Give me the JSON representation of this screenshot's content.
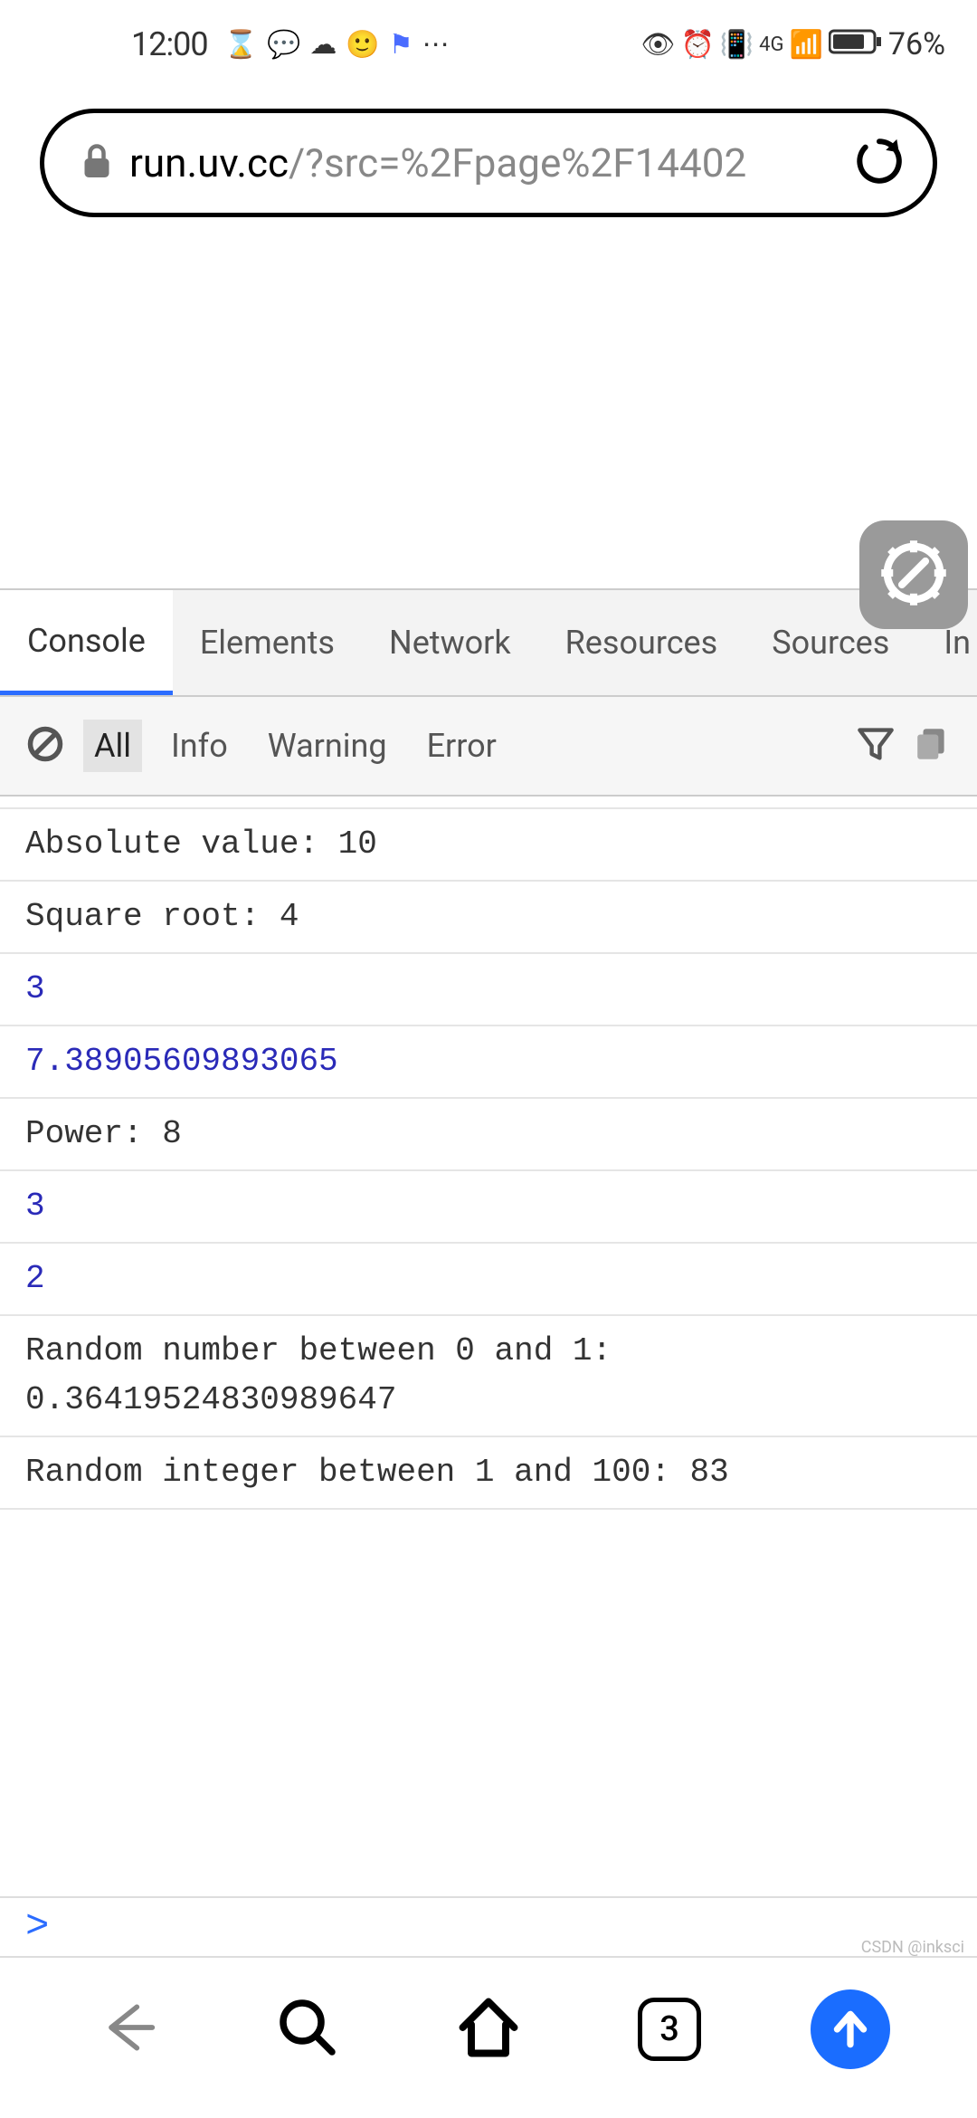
{
  "status": {
    "time": "12:00",
    "icons_left": [
      "hourglass",
      "chat-bubble",
      "wechat",
      "face",
      "flag",
      "more"
    ],
    "icons_right": [
      "eye",
      "alarm",
      "vibrate",
      "signal-4g",
      "signal-bars",
      "battery"
    ],
    "battery_percent": "76%"
  },
  "url": {
    "host": "run.uv.cc",
    "path": "/?src=%2Fpage%2F14402"
  },
  "devtools": {
    "tabs": [
      "Console",
      "Elements",
      "Network",
      "Resources",
      "Sources",
      "In"
    ],
    "active_tab_index": 0,
    "filters": [
      "All",
      "Info",
      "Warning",
      "Error"
    ],
    "active_filter_index": 0
  },
  "logs": [
    {
      "text": "Absolute value: 10",
      "type": "text"
    },
    {
      "text": "Square root: 4",
      "type": "text"
    },
    {
      "text": "3",
      "type": "numeric"
    },
    {
      "text": "7.38905609893065",
      "type": "numeric"
    },
    {
      "text": "Power: 8",
      "type": "text"
    },
    {
      "text": "3",
      "type": "numeric"
    },
    {
      "text": "2",
      "type": "numeric"
    },
    {
      "text": "Random number between 0 and 1: 0.36419524830989647",
      "type": "text"
    },
    {
      "text": "Random integer between 1 and 100: 83",
      "type": "text"
    }
  ],
  "prompt": {
    "symbol": ">"
  },
  "nav": {
    "tabs_count": "3"
  },
  "watermark": "CSDN @inksci"
}
